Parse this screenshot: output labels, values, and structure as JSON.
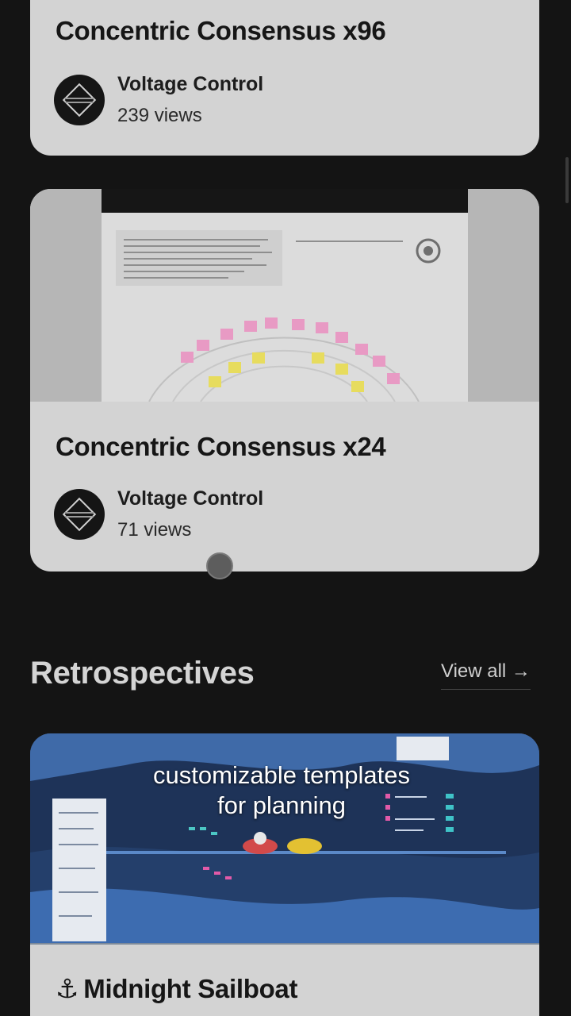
{
  "cards": [
    {
      "title": "Concentric Consensus x96",
      "author": "Voltage Control",
      "views": "239 views"
    },
    {
      "title": "Concentric Consensus x24",
      "author": "Voltage Control",
      "views": "71 views"
    }
  ],
  "section": {
    "title": "Retrospectives",
    "view_all": "View all →"
  },
  "retro_card": {
    "icon_glyph": "⚓",
    "title": "Midnight Sailboat"
  },
  "caption": {
    "line1": "customizable templates",
    "line2": "for planning"
  },
  "colors": {
    "background": "#141414",
    "card": "#d3d3d3",
    "text_light": "#d4d4d4"
  }
}
